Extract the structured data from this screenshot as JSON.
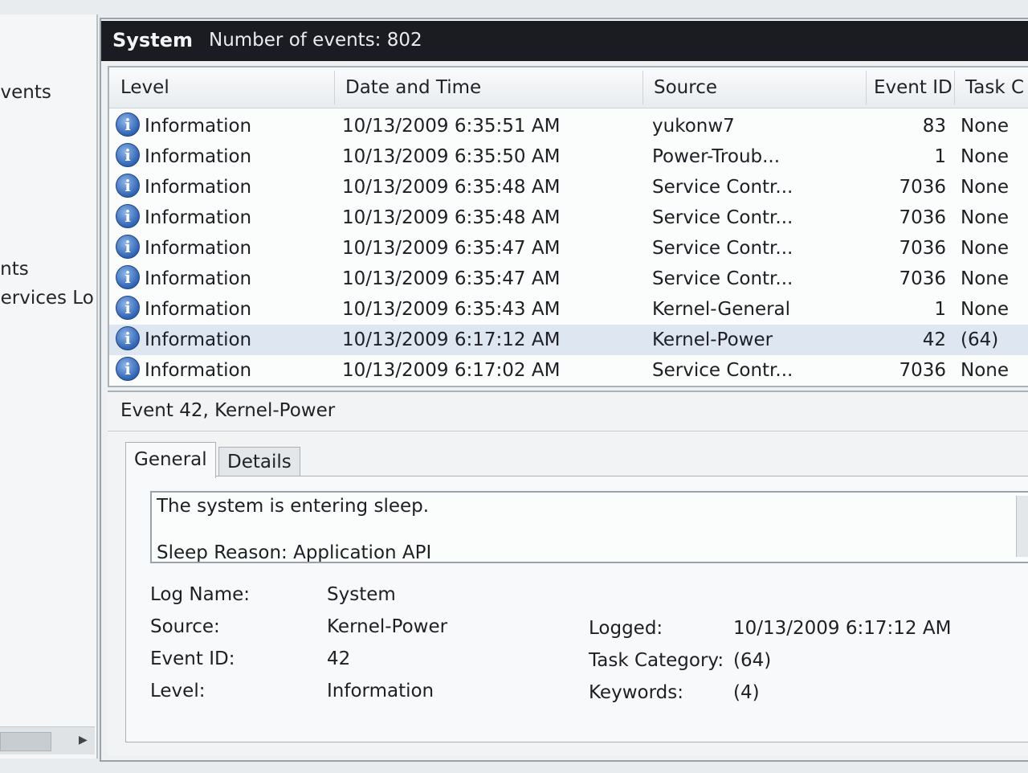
{
  "left_pane": {
    "items": [
      "Events",
      "ents",
      "Services Lo"
    ]
  },
  "header": {
    "log_name": "System",
    "event_count": "Number of events: 802"
  },
  "table": {
    "columns": [
      "Level",
      "Date and Time",
      "Source",
      "Event ID",
      "Task C"
    ],
    "rows": [
      {
        "level": "Information",
        "date": "10/13/2009 6:35:51 AM",
        "source": "yukonw7",
        "event_id": "83",
        "task": "None"
      },
      {
        "level": "Information",
        "date": "10/13/2009 6:35:50 AM",
        "source": "Power-Troub...",
        "event_id": "1",
        "task": "None"
      },
      {
        "level": "Information",
        "date": "10/13/2009 6:35:48 AM",
        "source": "Service Contr...",
        "event_id": "7036",
        "task": "None"
      },
      {
        "level": "Information",
        "date": "10/13/2009 6:35:48 AM",
        "source": "Service Contr...",
        "event_id": "7036",
        "task": "None"
      },
      {
        "level": "Information",
        "date": "10/13/2009 6:35:47 AM",
        "source": "Service Contr...",
        "event_id": "7036",
        "task": "None"
      },
      {
        "level": "Information",
        "date": "10/13/2009 6:35:47 AM",
        "source": "Service Contr...",
        "event_id": "7036",
        "task": "None"
      },
      {
        "level": "Information",
        "date": "10/13/2009 6:35:43 AM",
        "source": "Kernel-General",
        "event_id": "1",
        "task": "None"
      },
      {
        "level": "Information",
        "date": "10/13/2009 6:17:12 AM",
        "source": "Kernel-Power",
        "event_id": "42",
        "task": "(64)"
      },
      {
        "level": "Information",
        "date": "10/13/2009 6:17:02 AM",
        "source": "Service Contr...",
        "event_id": "7036",
        "task": "None"
      }
    ],
    "selected_row": 7
  },
  "detail": {
    "title": "Event 42, Kernel-Power",
    "tabs": [
      "General",
      "Details"
    ],
    "active_tab": "General",
    "message": [
      "The system is entering sleep.",
      "Sleep Reason: Application API"
    ],
    "properties": {
      "log_name_label": "Log Name:",
      "log_name": "System",
      "source_label": "Source:",
      "source": "Kernel-Power",
      "event_id_label": "Event ID:",
      "event_id": "42",
      "level_label": "Level:",
      "level": "Information",
      "logged_label": "Logged:",
      "logged": "10/13/2009 6:17:12 AM",
      "task_category_label": "Task Category:",
      "task_category": "(64)",
      "keywords_label": "Keywords:",
      "keywords": "(4)"
    }
  },
  "icons": {
    "level_icon": "information-icon"
  },
  "colors": {
    "header_bg": "#1a1c22",
    "selected_row": "#dde6f1",
    "info_icon": "#2f63b3"
  }
}
